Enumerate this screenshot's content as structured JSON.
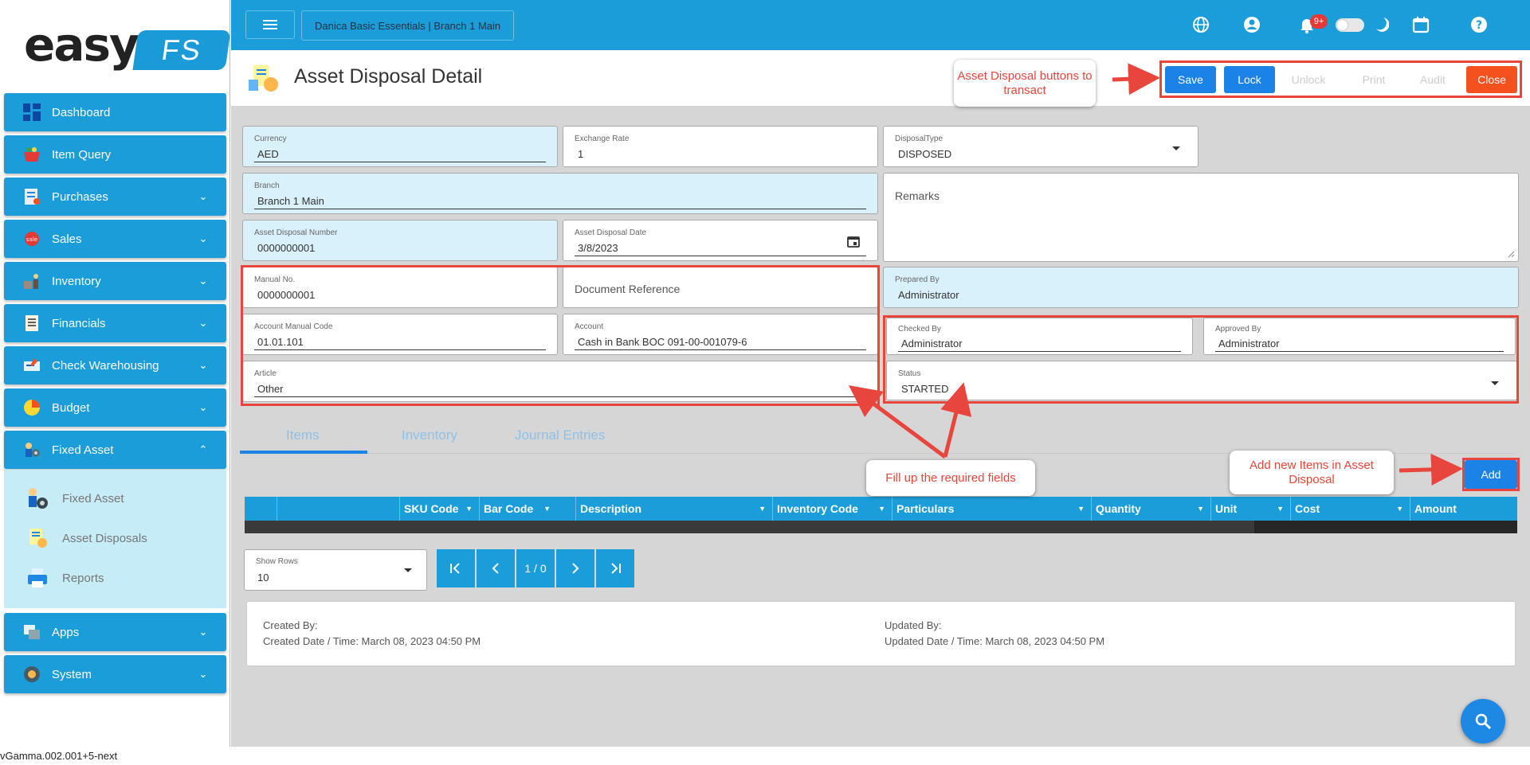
{
  "app": {
    "logo_word": "easy",
    "logo_badge": "FS",
    "version": "vGamma.002.001+5-next",
    "company": "Danica Basic Essentials | Branch 1 Main",
    "notif_count": "9+"
  },
  "colors": {
    "primary": "#1b9dd9",
    "accent": "#1b83e6",
    "danger": "#f4511e",
    "annotation": "#e8453c",
    "field_fill": "#d9f1fa"
  },
  "sidebar": {
    "items": [
      {
        "label": "Dashboard",
        "icon": "dashboard-icon"
      },
      {
        "label": "Item Query",
        "icon": "basket-icon"
      },
      {
        "label": "Purchases",
        "icon": "purchase-list-icon"
      },
      {
        "label": "Sales",
        "icon": "sale-tag-icon"
      },
      {
        "label": "Inventory",
        "icon": "warehouse-worker-icon"
      },
      {
        "label": "Financials",
        "icon": "ledger-icon"
      },
      {
        "label": "Check Warehousing",
        "icon": "check-icon"
      },
      {
        "label": "Budget",
        "icon": "pie-chart-icon"
      },
      {
        "label": "Fixed Asset",
        "icon": "fixed-asset-icon"
      },
      {
        "label": "Apps",
        "icon": "apps-icon"
      },
      {
        "label": "System",
        "icon": "gear-icon"
      }
    ],
    "fixed_asset_sub": [
      {
        "label": "Fixed Asset",
        "icon": "asset-gear-icon"
      },
      {
        "label": "Asset Disposals",
        "icon": "asset-disposal-icon"
      },
      {
        "label": "Reports",
        "icon": "printer-icon"
      }
    ]
  },
  "page": {
    "title": "Asset Disposal Detail",
    "buttons": {
      "save": "Save",
      "lock": "Lock",
      "unlock": "Unlock",
      "print": "Print",
      "audit": "Audit",
      "close": "Close"
    }
  },
  "form": {
    "currency": {
      "label": "Currency",
      "value": "AED"
    },
    "exchange_rate": {
      "label": "Exchange Rate",
      "value": "1"
    },
    "disposal_type": {
      "label": "DisposalType",
      "value": "DISPOSED"
    },
    "branch": {
      "label": "Branch",
      "value": "Branch 1 Main"
    },
    "remarks": {
      "placeholder": "Remarks"
    },
    "disposal_number": {
      "label": "Asset Disposal Number",
      "value": "0000000001"
    },
    "disposal_date": {
      "label": "Asset Disposal Date",
      "value": "3/8/2023"
    },
    "manual_no": {
      "label": "Manual No.",
      "value": "0000000001"
    },
    "document_reference": {
      "placeholder": "Document Reference"
    },
    "prepared_by": {
      "label": "Prepared By",
      "value": "Administrator"
    },
    "account_manual_code": {
      "label": "Account Manual Code",
      "value": "01.01.101"
    },
    "account": {
      "label": "Account",
      "value": "Cash in Bank BOC 091-00-001079-6"
    },
    "checked_by": {
      "label": "Checked By",
      "value": "Administrator"
    },
    "approved_by": {
      "label": "Approved By",
      "value": "Administrator"
    },
    "article": {
      "label": "Article",
      "value": "Other"
    },
    "status": {
      "label": "Status",
      "value": "STARTED"
    }
  },
  "tabs": [
    "Items",
    "Inventory",
    "Journal Entries"
  ],
  "add_label": "Add",
  "grid": {
    "columns": [
      "SKU Code",
      "Bar Code",
      "Description",
      "Inventory Code",
      "Particulars",
      "Quantity",
      "Unit",
      "Cost",
      "Amount"
    ]
  },
  "pagination": {
    "show_rows_label": "Show Rows",
    "rows_value": "10",
    "page_indicator": "1 / 0"
  },
  "audit": {
    "created_by": "Created By:",
    "created_date": "Created Date / Time: March 08, 2023 04:50 PM",
    "updated_by": "Updated By:",
    "updated_date": "Updated Date / Time: March 08, 2023 04:50 PM"
  },
  "callouts": {
    "buttons": "Asset Disposal buttons to transact",
    "fields": "Fill up the required fields",
    "add_items": "Add new Items in Asset Disposal"
  }
}
